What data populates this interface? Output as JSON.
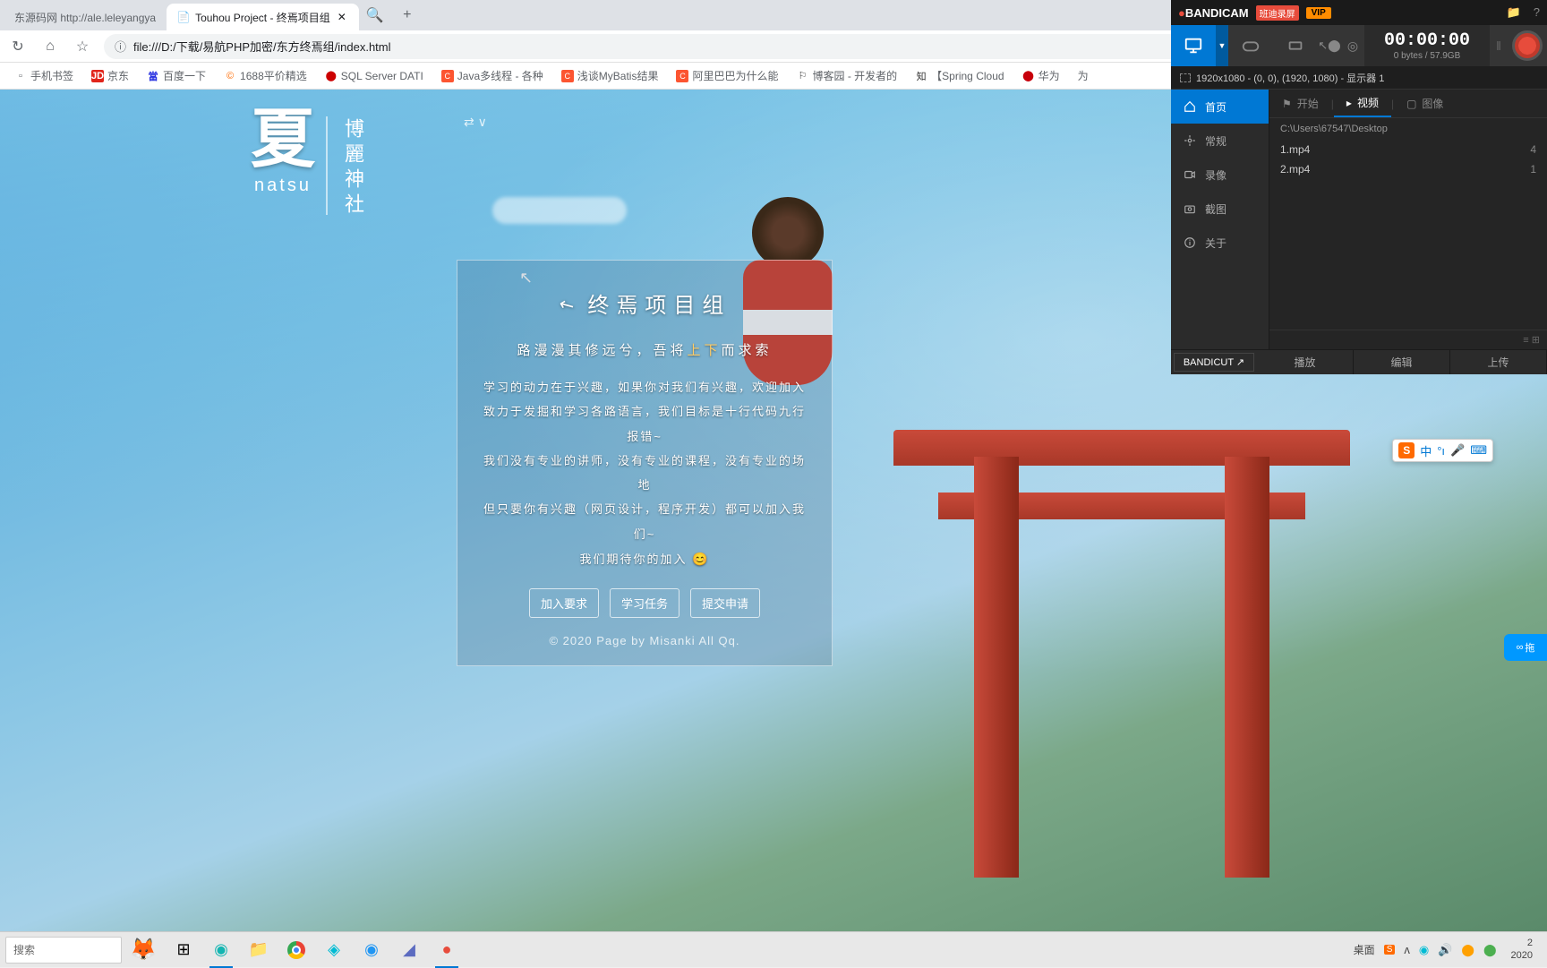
{
  "browser": {
    "tabs": [
      {
        "title": "东源码网 http://ale.leleyangya",
        "active": false
      },
      {
        "title": "Touhou Project - 终焉项目组",
        "active": true
      }
    ],
    "url": "file:///D:/下载/易航PHP加密/东方终焉组/index.html",
    "bookmarks": [
      {
        "label": "手机书签",
        "icon": ""
      },
      {
        "label": "京东",
        "icon": "JD"
      },
      {
        "label": "百度一下",
        "icon": "當"
      },
      {
        "label": "1688平价精选",
        "icon": "©"
      },
      {
        "label": "SQL Server DATI",
        "icon": "⬤"
      },
      {
        "label": "Java多线程 - 各种",
        "icon": "C"
      },
      {
        "label": "浅谈MyBatis结果",
        "icon": "C"
      },
      {
        "label": "阿里巴巴为什么能",
        "icon": "C"
      },
      {
        "label": "博客园 - 开发者的",
        "icon": "⚐"
      },
      {
        "label": "【Spring Cloud",
        "icon": "知"
      },
      {
        "label": "华为",
        "icon": "⬤"
      },
      {
        "label": "为",
        "icon": ""
      }
    ]
  },
  "page": {
    "logo_kanji": "夏",
    "logo_romaji": "natsu",
    "logo_side": "博麗神社",
    "logo_arrow": "⇄ ∨",
    "card": {
      "title": "终焉项目组",
      "subtitle_a": "路漫漫其修远兮，吾将",
      "subtitle_hl": "上下",
      "subtitle_b": "而求索",
      "line1": "学习的动力在于兴趣，如果你对我们有兴趣，欢迎加入",
      "line2": "致力于发掘和学习各路语言，我们目标是十行代码九行报错~",
      "line3": "我们没有专业的讲师，没有专业的课程，没有专业的场地",
      "line4": "但只要你有兴趣（网页设计，程序开发）都可以加入我们~",
      "line5": "我们期待你的加入",
      "emoji": "😊",
      "btn1": "加入要求",
      "btn2": "学习任务",
      "btn3": "提交申请",
      "footer": "© 2020 Page by Misanki All Qq."
    }
  },
  "bandicam": {
    "logo_pre": "BANDI",
    "logo_suf": "CAM",
    "badge": "班迪录屏",
    "vip": "VIP",
    "time": "00:00:00",
    "bytes": "0 bytes / 57.9GB",
    "display_info": "1920x1080 - (0, 0), (1920, 1080) - 显示器 1",
    "nav": {
      "home": "首页",
      "general": "常规",
      "record": "录像",
      "screenshot": "截图",
      "about": "关于"
    },
    "tabs": {
      "start": "开始",
      "video": "视频",
      "image": "图像"
    },
    "path": "C:\\Users\\67547\\Desktop",
    "files": [
      {
        "name": "1.mp4",
        "size": "4"
      },
      {
        "name": "2.mp4",
        "size": "1"
      }
    ],
    "cut": "BANDICUT ↗",
    "foot": {
      "play": "播放",
      "edit": "编辑",
      "upload": "上传"
    }
  },
  "ime": {
    "ch": "中",
    "dot": "°ı"
  },
  "float": "拖",
  "taskbar": {
    "search": "搜索",
    "tray_desktop": "桌面",
    "clock_time": "2",
    "clock_date": "2020"
  }
}
